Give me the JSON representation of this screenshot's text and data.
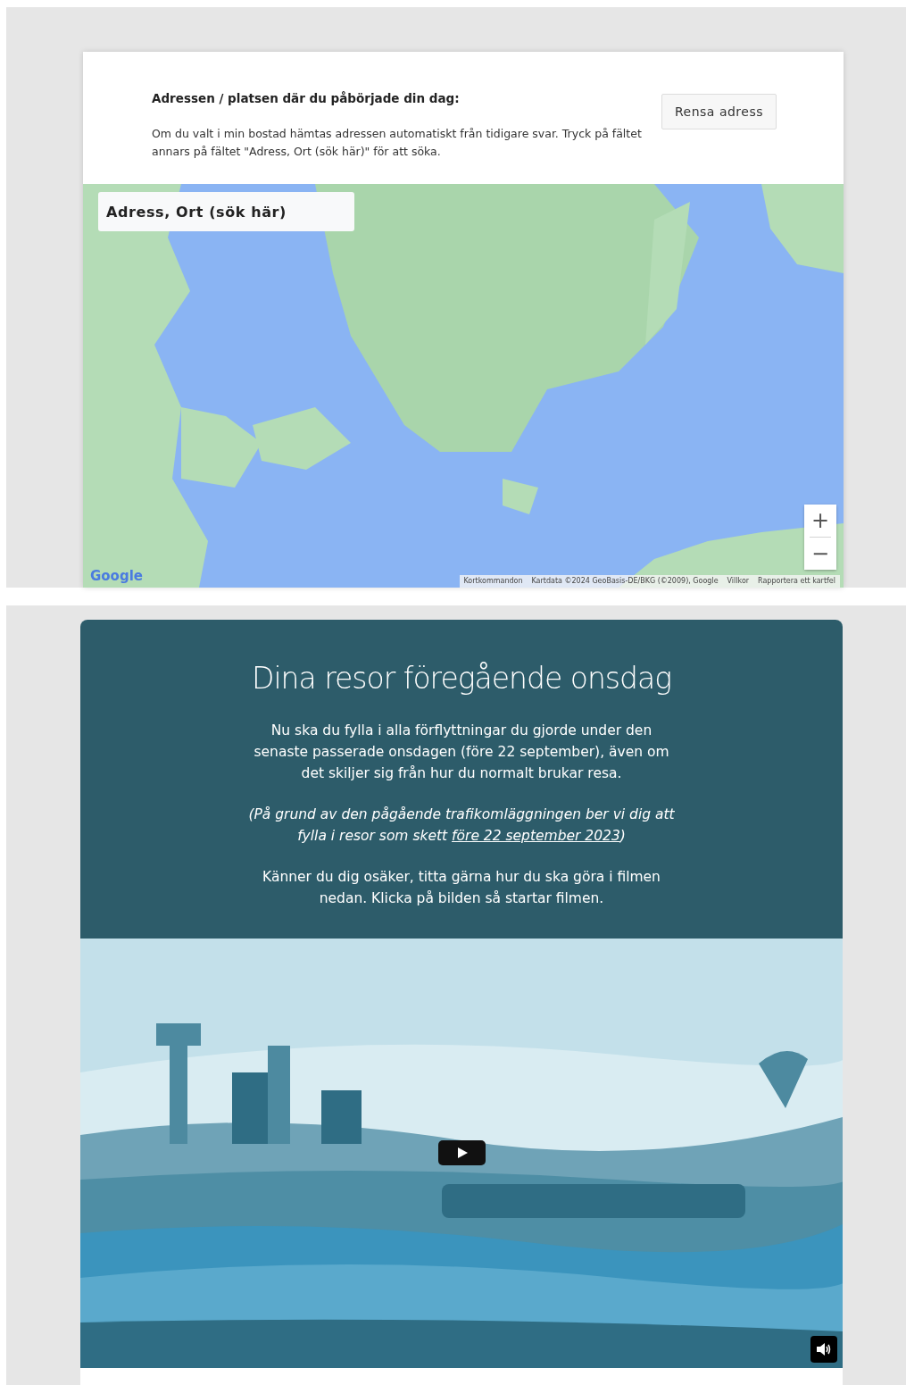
{
  "address_section": {
    "heading": "Adressen / platsen där du påbörjade din dag:",
    "help_text": "Om du valt i min bostad hämtas adressen automatiskt från tidigare svar. Tryck på fältet annars på fältet \"Adress, Ort (sök här)\" för att söka.",
    "clear_button": "Rensa adress"
  },
  "map": {
    "search": {
      "placeholder": "Adress, Ort (sök här)"
    },
    "zoom_in": "+",
    "zoom_out": "−",
    "logo": "Google",
    "attribution": [
      "Kortkommandon",
      "Kartdata ©2024 GeoBasis-DE/BKG (©2009), Google",
      "Villkor",
      "Rapportera ett kartfel"
    ]
  },
  "trips_section": {
    "title": "Dina resor föregående onsdag",
    "paragraphs": [
      {
        "kind": "plain",
        "text": "Nu ska du fylla i alla förflyttningar du gjorde under den senaste passerade onsdagen (före 22 september), även om det skiljer sig från hur du normalt brukar resa."
      },
      {
        "kind": "italic",
        "text_before": "(På grund av den pågående trafikomläggningen ber vi dig att fylla i resor som skett ",
        "link": "före 22 september 2023",
        "text_after": ")"
      },
      {
        "kind": "plain",
        "text": "Känner du dig osäker, titta gärna hur du ska göra i filmen nedan. Klicka på bilden så startar filmen."
      }
    ]
  }
}
